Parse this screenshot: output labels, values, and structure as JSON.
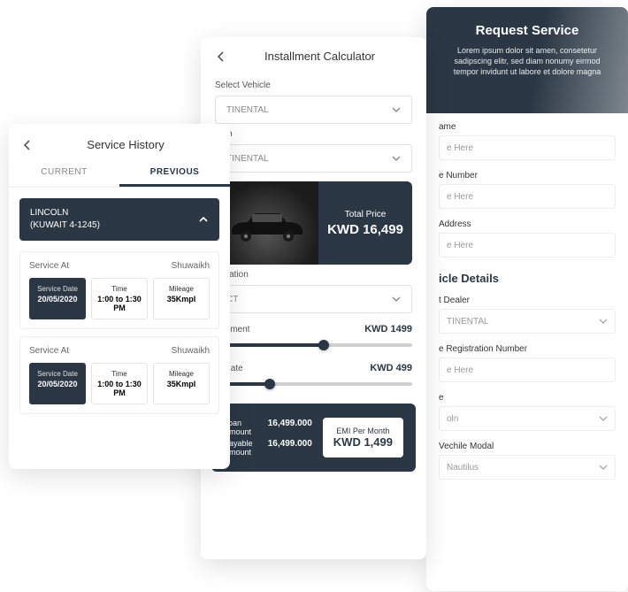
{
  "request": {
    "title": "Request Service",
    "desc": "Lorem ipsum dolor sit amen, consetetur sadipscing elitr, sed diam nonumy eirmod tempor invidunt ut labore et dolore magna",
    "name_label": "ame",
    "name_ph": "e Here",
    "phone_label": "e Number",
    "phone_ph": "e Here",
    "addr_label": "Address",
    "addr_ph": "e Here",
    "details_title": "icle Details",
    "dealer_label": "t Dealer",
    "dealer_val": "TINENTAL",
    "reg_label": "e Registration Number",
    "reg_ph": "e Here",
    "make_label": "e",
    "make_val": "oln",
    "model_label": "Vechile Modal",
    "model_val": "Nautilus"
  },
  "calc": {
    "title": "Installment Calculator",
    "select_vehicle_label": "Select Vehicle",
    "select_vehicle_val": "TINENTAL",
    "select_trim_label": "Trim",
    "select_trim_val": "TINENTAL",
    "total_price_label": "Total Price",
    "total_price_val": "KWD 16,499",
    "duration_label": "Duration",
    "duration_val": "CT",
    "down_label": "Payment",
    "down_val": "KWD 1499",
    "rate_label": "st Rate",
    "rate_val": "KWD 499",
    "down_pct": 55,
    "rate_pct": 28,
    "loan_label": "Loan Amount",
    "loan_val": "16,499.000",
    "payable_label": "Payable Amount",
    "payable_val": "16,499.000",
    "emi_label": "EMI Per Month",
    "emi_val": "KWD 1,499"
  },
  "history": {
    "title": "Service History",
    "tab_current": "CURRENT",
    "tab_previous": "PREVIOUS",
    "acc_brand": "LINCOLN",
    "acc_plate": "(KUWAIT 4-1245)",
    "rows": [
      {
        "at_label": "Service At",
        "at_value": "Shuwaikh",
        "date_label": "Service Date",
        "date_val": "20/05/2020",
        "time_label": "Time",
        "time_val": "1:00 to 1:30 PM",
        "mileage_label": "Mileage",
        "mileage_val": "35Kmpl"
      },
      {
        "at_label": "Service At",
        "at_value": "Shuwaikh",
        "date_label": "Service Date",
        "date_val": "20/05/2020",
        "time_label": "Time",
        "time_val": "1:00 to 1:30 PM",
        "mileage_label": "Mileage",
        "mileage_val": "35Kmpl"
      }
    ]
  }
}
